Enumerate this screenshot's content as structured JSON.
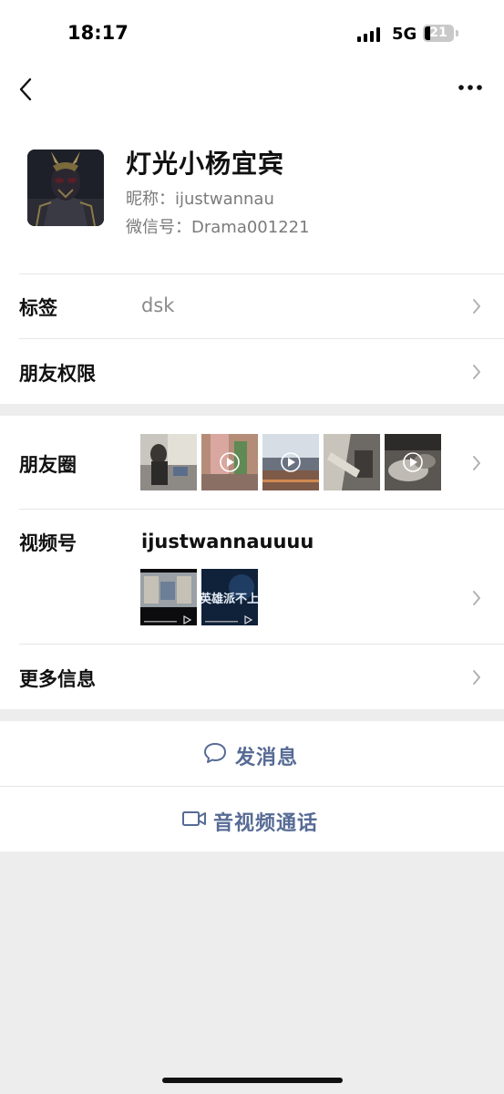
{
  "status_bar": {
    "time": "18:17",
    "network": "5G",
    "battery": "21"
  },
  "profile": {
    "name": "灯光小杨宜宾",
    "nickname": "昵称：ijustwannau",
    "wechat_id": "微信号：Drama001221"
  },
  "rows": {
    "tags": {
      "label": "标签",
      "value": "dsk"
    },
    "permissions": {
      "label": "朋友权限"
    },
    "moments": {
      "label": "朋友圈"
    },
    "channels": {
      "label": "视频号",
      "account": "ijustwannauuuu",
      "cover_text": "英雄派不上"
    },
    "more_info": {
      "label": "更多信息"
    }
  },
  "actions": {
    "send_message": "发消息",
    "video_call": "音视频通话"
  },
  "colors": {
    "link_blue": "#566b95",
    "background": "#ededed"
  }
}
